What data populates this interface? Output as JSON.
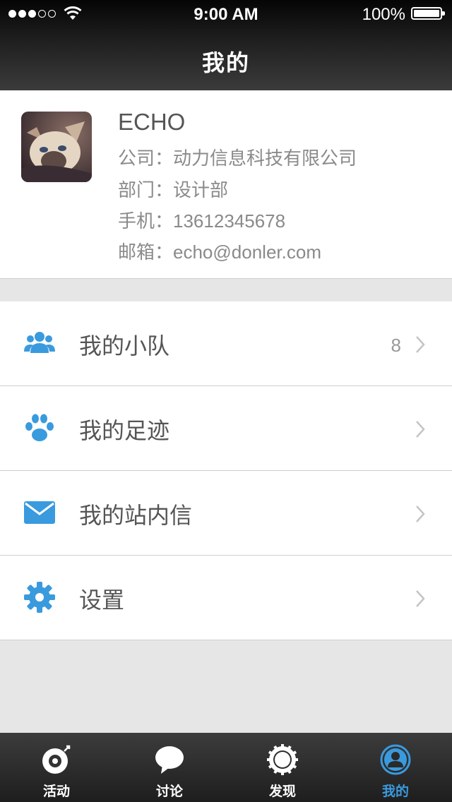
{
  "status": {
    "time": "9:00 AM",
    "battery": "100%"
  },
  "nav": {
    "title": "我的"
  },
  "profile": {
    "name": "ECHO",
    "company_label": "公司：",
    "company": "动力信息科技有限公司",
    "dept_label": "部门：",
    "dept": "设计部",
    "phone_label": "手机：",
    "phone": "13612345678",
    "email_label": "邮箱：",
    "email": "echo@donler.com"
  },
  "menu": {
    "items": [
      {
        "label": "我的小队",
        "icon": "team-icon",
        "count": "8"
      },
      {
        "label": "我的足迹",
        "icon": "paw-icon",
        "count": ""
      },
      {
        "label": "我的站内信",
        "icon": "mail-icon",
        "count": ""
      },
      {
        "label": "设置",
        "icon": "gear-icon",
        "count": ""
      }
    ]
  },
  "tabs": [
    {
      "label": "活动",
      "icon": "activity-icon"
    },
    {
      "label": "讨论",
      "icon": "chat-icon"
    },
    {
      "label": "发现",
      "icon": "discover-icon"
    },
    {
      "label": "我的",
      "icon": "user-icon",
      "active": true
    }
  ],
  "colors": {
    "accent": "#3a9ade",
    "nav_bg": "#1f1f1f",
    "text": "#555555"
  }
}
